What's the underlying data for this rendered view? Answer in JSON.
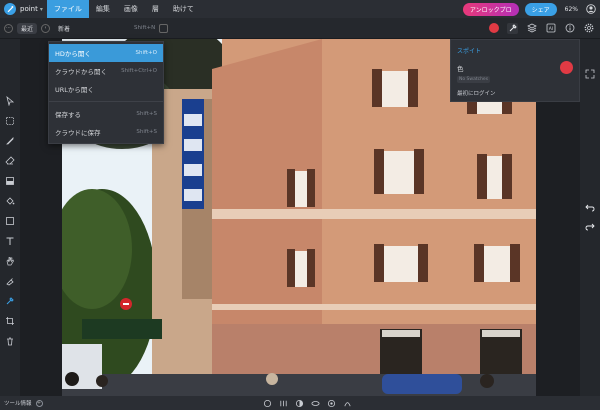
{
  "app": {
    "name": "point"
  },
  "menubar": {
    "items": [
      {
        "label": "ファイル",
        "active": true
      },
      {
        "label": "編集"
      },
      {
        "label": "画像"
      },
      {
        "label": "層"
      },
      {
        "label": "助けて"
      }
    ],
    "unlock_label": "アンロックプロ",
    "share_label": "シェア",
    "zoom": "62%"
  },
  "optionsbar": {
    "back_label": "最近",
    "new_label": "新着",
    "new_shortcut": "Shift+N",
    "color_accent": "#e03a44"
  },
  "file_menu": {
    "items": [
      {
        "label": "HDから開く",
        "shortcut": "Shift+O",
        "active": true
      },
      {
        "label": "クラウドから開く",
        "shortcut": "Shift+Ctrl+O"
      },
      {
        "label": "URLから開く",
        "shortcut": ""
      },
      {
        "label": "保存する",
        "shortcut": "Shift+S"
      },
      {
        "label": "クラウドに保存",
        "shortcut": "Shift+S"
      }
    ]
  },
  "picker_panel": {
    "title": "スポイト",
    "color_label": "色",
    "hint": "No Swatches",
    "login": "最初にログイン"
  },
  "statusbar": {
    "label": "ツール情報"
  },
  "colors": {
    "accent_blue": "#3aa0e6",
    "brand_gradient_start": "#e8397a",
    "brand_gradient_end": "#b32fb8",
    "picked_color": "#e03a44"
  }
}
